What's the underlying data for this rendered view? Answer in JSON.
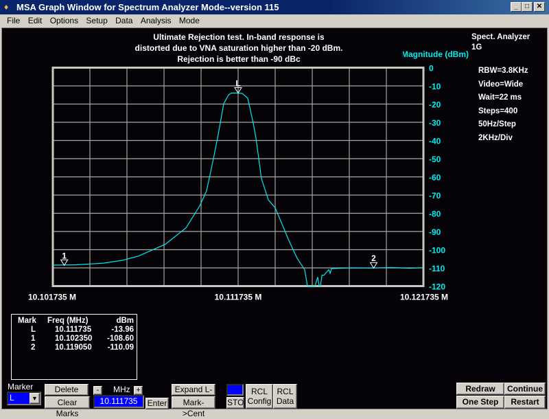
{
  "window": {
    "title": "MSA Graph Window for Spectrum Analyzer Mode--version 115",
    "min": "_",
    "max": "□",
    "close": "✕"
  },
  "menu": [
    "File",
    "Edit",
    "Options",
    "Setup",
    "Data",
    "Analysis",
    "Mode"
  ],
  "note": [
    "Ultimate Rejection test.  In-band response is",
    "distorted due to VNA saturation higher than -20 dBm.",
    "Rejection is better than -90 dBc"
  ],
  "info": {
    "mode": "Spect. Analyzer",
    "band": "1G",
    "settings": [
      "RBW=3.8KHz",
      "Video=Wide",
      "Wait=22 ms",
      "Steps=400",
      "50Hz/Step",
      "2KHz/Div"
    ]
  },
  "chart_data": {
    "type": "line",
    "ylabel": "Magnitude (dBm)",
    "ylim": [
      -120,
      0
    ],
    "xlim": [
      10.101735,
      10.121735
    ],
    "y_ticks": [
      "0",
      "-10",
      "-20",
      "-30",
      "-40",
      "-50",
      "-60",
      "-70",
      "-80",
      "-90",
      "-100",
      "-110",
      "-120"
    ],
    "x_tick_labels": [
      "10.101735 M",
      "10.111735 M",
      "10.121735 M"
    ],
    "grid": true,
    "trace_color": "#00e8f0",
    "series": [
      {
        "x": [
          10.101735,
          10.103,
          10.104476,
          10.1055,
          10.106328,
          10.107809,
          10.10892,
          10.109661,
          10.110031,
          10.110402,
          10.110624,
          10.110957,
          10.111216,
          10.111365,
          10.111735,
          10.111957,
          10.112254,
          10.11255,
          10.112698,
          10.112994,
          10.113365,
          10.113735,
          10.114105,
          10.114476,
          10.11492,
          10.115328,
          10.115476,
          10.115883,
          10.116031,
          10.116105,
          10.116179,
          10.11626,
          10.116365,
          10.116624,
          10.1167,
          10.116772,
          10.117068,
          10.117809,
          10.11905,
          10.120031,
          10.121,
          10.121735
        ],
        "y": [
          -108.5,
          -108.3,
          -107.4,
          -105.8,
          -103.6,
          -97,
          -88,
          -76,
          -67.7,
          -50,
          -38.7,
          -19.8,
          -15,
          -13.96,
          -13.96,
          -14.2,
          -16.8,
          -30.4,
          -38.7,
          -61,
          -72.6,
          -77,
          -86,
          -95,
          -104.7,
          -111,
          -120,
          -120,
          -115,
          -120,
          -120,
          -114,
          -114,
          -111,
          -113,
          -110.4,
          -110.3,
          -110,
          -110.09,
          -109.8,
          -110.2,
          -109.9
        ]
      }
    ],
    "markers": [
      {
        "label": "L",
        "x": 10.111735,
        "y": -13.96
      },
      {
        "label": "1",
        "x": 10.10235,
        "y": -108.6
      },
      {
        "label": "2",
        "x": 10.11905,
        "y": -110.09
      }
    ]
  },
  "marker_table": {
    "headers": [
      "Mark",
      "Freq (MHz)",
      "dBm"
    ],
    "rows": [
      [
        "L",
        "10.111735",
        "-13.96"
      ],
      [
        "1",
        "10.102350",
        "-108.60"
      ],
      [
        "2",
        "10.119050",
        "-110.09"
      ]
    ]
  },
  "controls": {
    "marker_label": "Marker",
    "marker_value": "L",
    "delete": "Delete",
    "clear_marks": "Clear Marks",
    "minus": "-",
    "mhz": "MHz",
    "plus": "+",
    "freq_value": "10.111735",
    "enter": "Enter",
    "expand": "Expand L-R",
    "mark_cent": "Mark->Cent",
    "sto": "STO",
    "rcl_config": [
      "RCL",
      "Config"
    ],
    "rcl_data": [
      "RCL",
      "Data"
    ],
    "redraw": "Redraw",
    "continue": "Continue",
    "one_step": "One Step",
    "restart": "Restart"
  }
}
